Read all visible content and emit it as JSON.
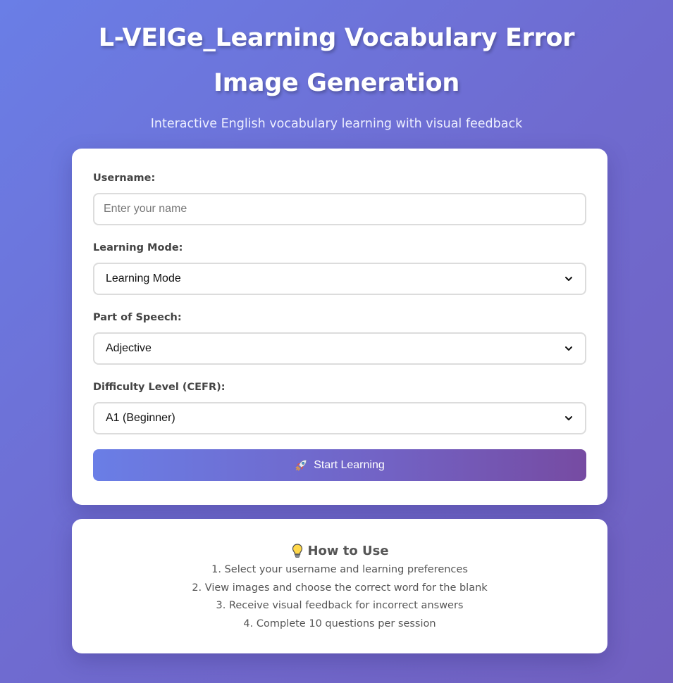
{
  "header": {
    "title": "L-VEIGe_Learning Vocabulary Error Image Generation",
    "subtitle": "Interactive English vocabulary learning with visual feedback"
  },
  "form": {
    "username": {
      "label": "Username:",
      "placeholder": "Enter your name",
      "value": ""
    },
    "learning_mode": {
      "label": "Learning Mode:",
      "selected": "Learning Mode"
    },
    "part_of_speech": {
      "label": "Part of Speech:",
      "selected": "Adjective"
    },
    "difficulty": {
      "label": "Difficulty Level (CEFR):",
      "selected": "A1 (Beginner)"
    },
    "start_button": {
      "label": "Start Learning",
      "icon": "rocket-icon"
    }
  },
  "how_to_use": {
    "title": "How to Use",
    "icon": "lightbulb-icon",
    "steps": [
      "1. Select your username and learning preferences",
      "2. View images and choose the correct word for the blank",
      "3. Receive visual feedback for incorrect answers",
      "4. Complete 10 questions per session"
    ]
  },
  "colors": {
    "background_start": "#6a7ee6",
    "background_end": "#7160c0",
    "button_start": "#6a7ee6",
    "button_end": "#764ba2"
  }
}
